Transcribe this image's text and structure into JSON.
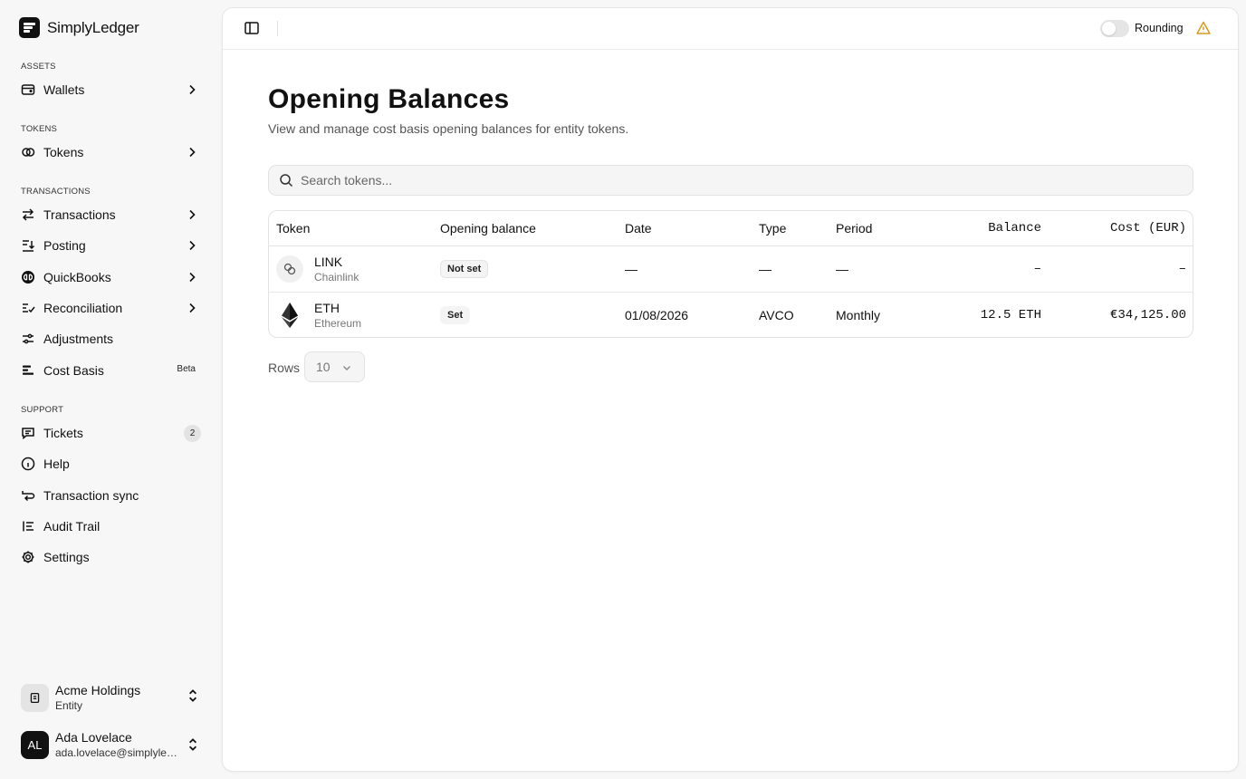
{
  "brand": {
    "name": "SimplyLedger"
  },
  "sidebar": {
    "sections": {
      "assets": "ASSETS",
      "tokens": "TOKENS",
      "transactions": "TRANSACTIONS",
      "support": "SUPPORT"
    },
    "items": [
      {
        "label": "Wallets",
        "icon": "wallet-icon"
      },
      {
        "label": "Tokens",
        "icon": "coins-icon"
      },
      {
        "label": "Transactions",
        "icon": "arrows-swap-icon"
      },
      {
        "label": "Posting",
        "icon": "list-arrow-down-icon"
      },
      {
        "label": "QuickBooks",
        "icon": "quickbooks-icon"
      },
      {
        "label": "Reconciliation",
        "icon": "list-check-icon"
      },
      {
        "label": "Adjustments",
        "icon": "sliders-icon"
      },
      {
        "label": "Cost Basis",
        "icon": "bars-icon",
        "badge": "Beta"
      },
      {
        "label": "Tickets",
        "icon": "message-icon",
        "count": "2"
      },
      {
        "label": "Help",
        "icon": "info-circle-icon"
      },
      {
        "label": "Transaction sync",
        "icon": "sync-arrow-icon"
      },
      {
        "label": "Audit Trail",
        "icon": "list-bullet-icon"
      },
      {
        "label": "Settings",
        "icon": "gear-icon"
      }
    ],
    "org": {
      "name": "Acme Holdings",
      "type": "Entity"
    },
    "user": {
      "initials": "AL",
      "name": "Ada Lovelace",
      "email": "ada.lovelace@simplyled..."
    }
  },
  "topbar": {
    "rounding_label": "Rounding",
    "rounding_enabled": false,
    "warning_color": "#d99a1e"
  },
  "page": {
    "title": "Opening Balances",
    "subtitle": "View and manage cost basis opening balances for entity tokens.",
    "search_placeholder": "Search tokens..."
  },
  "table": {
    "columns": [
      "Token",
      "Opening balance",
      "Date",
      "Type",
      "Period",
      "Balance",
      "Cost (EUR)"
    ],
    "rows": [
      {
        "symbol": "LINK",
        "name": "Chainlink",
        "opening_balance": "Not set",
        "date": "—",
        "type": "—",
        "period": "—",
        "balance": "–",
        "cost": "–"
      },
      {
        "symbol": "ETH",
        "name": "Ethereum",
        "opening_balance": "Set",
        "date": "01/08/2026",
        "type": "AVCO",
        "period": "Monthly",
        "balance": "12.5 ETH",
        "cost": "€34,125.00"
      }
    ]
  },
  "pagination": {
    "rows_label": "Rows",
    "rows_value": "10"
  }
}
